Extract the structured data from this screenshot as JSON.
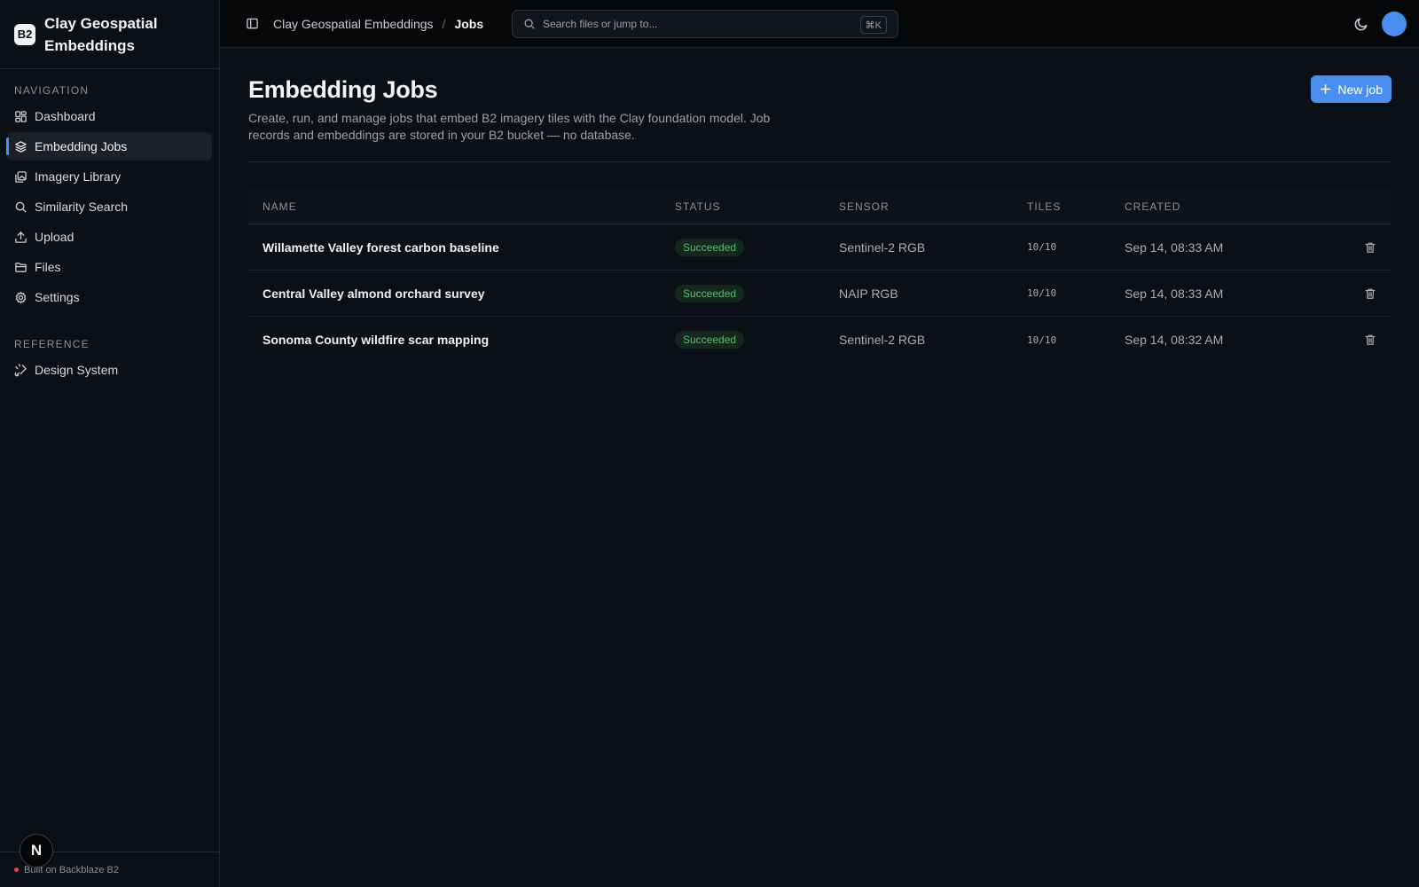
{
  "brand": {
    "logo": "B2",
    "name": "Clay Geospatial Embeddings"
  },
  "sidebar": {
    "nav_title": "Navigation",
    "items": [
      {
        "label": "Dashboard",
        "icon": "grid-icon"
      },
      {
        "label": "Embedding Jobs",
        "icon": "layers-icon",
        "active": true
      },
      {
        "label": "Imagery Library",
        "icon": "images-icon"
      },
      {
        "label": "Similarity Search",
        "icon": "search-icon"
      },
      {
        "label": "Upload",
        "icon": "upload-icon"
      },
      {
        "label": "Files",
        "icon": "folder-icon"
      },
      {
        "label": "Settings",
        "icon": "gear-icon"
      }
    ],
    "ref_title": "Reference",
    "ref_items": [
      {
        "label": "Design System",
        "icon": "palette-icon"
      }
    ],
    "footer": "Built on Backblaze B2",
    "next_badge": "N"
  },
  "topbar": {
    "breadcrumb_root": "Clay Geospatial Embeddings",
    "breadcrumb_sep": "/",
    "breadcrumb_current": "Jobs",
    "search_placeholder": "Search files or jump to...",
    "search_kbd": "⌘K"
  },
  "page": {
    "title": "Embedding Jobs",
    "description": "Create, run, and manage jobs that embed B2 imagery tiles with the Clay foundation model. Job records and embeddings are stored in your B2 bucket — no database.",
    "new_button": "New job"
  },
  "table": {
    "columns": [
      "Name",
      "Status",
      "Sensor",
      "Tiles",
      "Created"
    ],
    "rows": [
      {
        "name": "Willamette Valley forest carbon baseline",
        "status": "Succeeded",
        "sensor": "Sentinel-2 RGB",
        "tiles": "10/10",
        "created": "Sep 14, 08:33 AM"
      },
      {
        "name": "Central Valley almond orchard survey",
        "status": "Succeeded",
        "sensor": "NAIP RGB",
        "tiles": "10/10",
        "created": "Sep 14, 08:33 AM"
      },
      {
        "name": "Sonoma County wildfire scar mapping",
        "status": "Succeeded",
        "sensor": "Sentinel-2 RGB",
        "tiles": "10/10",
        "created": "Sep 14, 08:32 AM"
      }
    ]
  },
  "colors": {
    "accent": "#4a8ff0",
    "success": "#4cc26e",
    "background": "#0b0f16"
  }
}
